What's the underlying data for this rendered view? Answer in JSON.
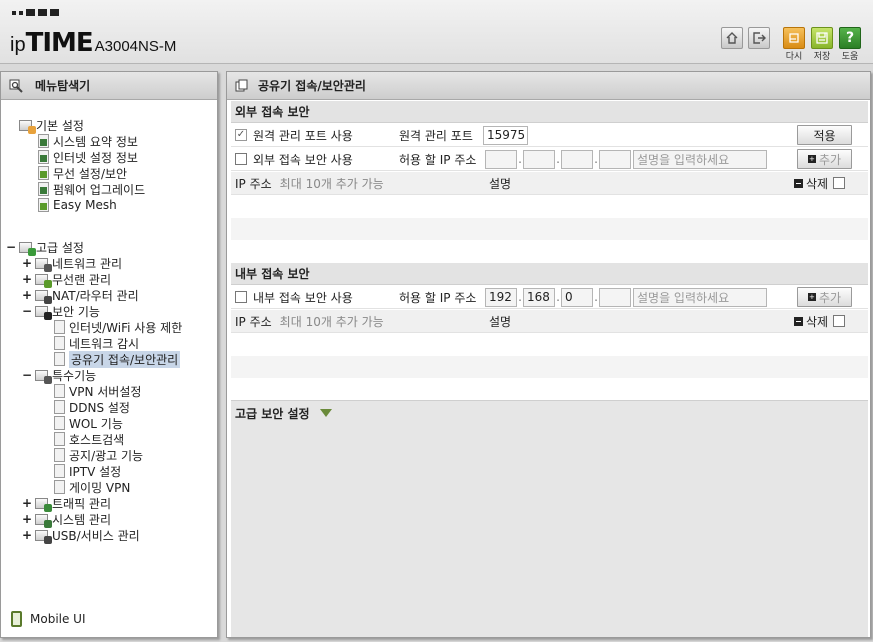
{
  "header": {
    "brand_ip": "ip",
    "brand_time": "TIME",
    "model": "A3004NS-M",
    "buttons": {
      "home_icon": "home-icon",
      "logout_icon": "logout-icon",
      "restart_label": "다시",
      "save_label": "저장",
      "help_label": "도움",
      "help_glyph": "?"
    }
  },
  "sidebar": {
    "title": "메뉴탐색기",
    "basic": {
      "label": "기본 설정",
      "items": [
        "시스템 요약 정보",
        "인터넷 설정 정보",
        "무선 설정/보안",
        "펌웨어 업그레이드",
        "Easy Mesh"
      ]
    },
    "advanced": {
      "toggle": "−",
      "label": "고급 설정",
      "groups": [
        {
          "toggle": "+",
          "label": "네트워크 관리"
        },
        {
          "toggle": "+",
          "label": "무선랜 관리"
        },
        {
          "toggle": "+",
          "label": "NAT/라우터 관리"
        },
        {
          "toggle": "−",
          "label": "보안 기능"
        },
        {
          "toggle": "−",
          "label": "특수기능"
        },
        {
          "toggle": "+",
          "label": "트래픽 관리"
        },
        {
          "toggle": "+",
          "label": "시스템 관리"
        },
        {
          "toggle": "+",
          "label": "USB/서비스 관리"
        }
      ],
      "security_items": [
        "인터넷/WiFi 사용 제한",
        "네트워크 감시",
        "공유기 접속/보안관리"
      ],
      "special_items": [
        "VPN 서버설정",
        "DDNS 설정",
        "WOL 기능",
        "호스트검색",
        "공지/광고 기능",
        "IPTV 설정",
        "게이밍 VPN"
      ]
    },
    "mobile_label": "Mobile UI"
  },
  "main": {
    "title": "공유기 접속/보안관리",
    "external": {
      "title": "외부 접속 보안",
      "remote_port_check": "원격 관리 포트 사용",
      "remote_port_label": "원격 관리 포트",
      "remote_port_value": "15975",
      "apply_label": "적용",
      "ext_check": "외부 접속 보안 사용",
      "allow_ip_label": "허용 할 IP 주소",
      "ip": [
        "",
        "",
        "",
        ""
      ],
      "desc_placeholder": "설명을 입력하세요",
      "add_label": "추가",
      "list_ip_header": "IP 주소",
      "list_max": "최대 10개 추가 가능",
      "list_desc_header": "설명",
      "delete_label": "삭제"
    },
    "internal": {
      "title": "내부 접속 보안",
      "int_check": "내부 접속 보안 사용",
      "allow_ip_label": "허용 할 IP 주소",
      "ip": [
        "192",
        "168",
        "0",
        ""
      ],
      "desc_placeholder": "설명을 입력하세요",
      "add_label": "추가",
      "list_ip_header": "IP 주소",
      "list_max": "최대 10개 추가 가능",
      "list_desc_header": "설명",
      "delete_label": "삭제"
    },
    "advanced_title": "고급 보안 설정"
  },
  "colors": {
    "accent_green": "#6a8a3a",
    "selected_bg": "#c8d6e8",
    "section_bg": "#e3e3e3"
  }
}
